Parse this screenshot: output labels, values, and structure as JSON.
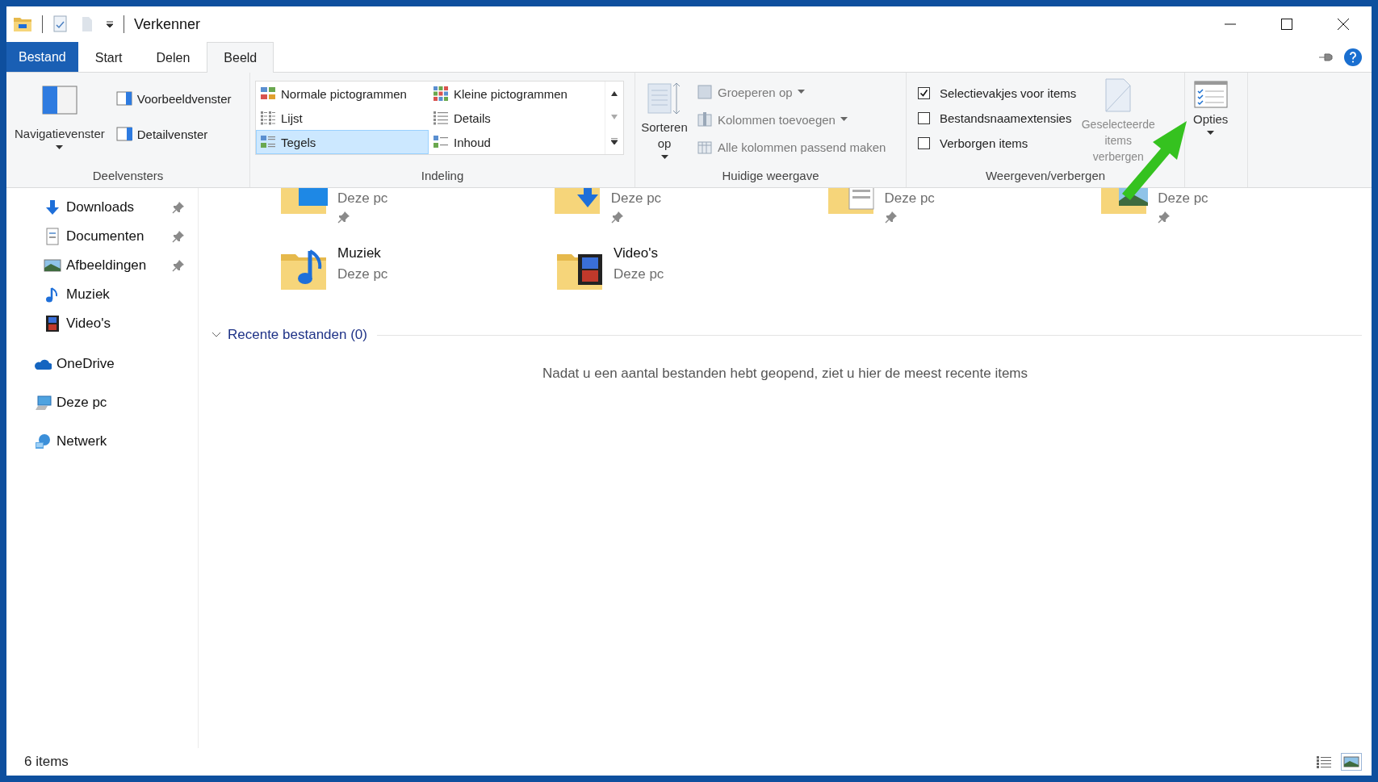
{
  "window": {
    "title": "Verkenner"
  },
  "ribbon_tabs": [
    {
      "label": "Bestand",
      "kind": "file",
      "selected": false
    },
    {
      "label": "Start",
      "kind": "tab",
      "selected": false
    },
    {
      "label": "Delen",
      "kind": "tab",
      "selected": false
    },
    {
      "label": "Beeld",
      "kind": "tab",
      "selected": true
    }
  ],
  "panes_group": {
    "label": "Deelvensters",
    "navigation_pane": "Navigatievenster",
    "items": [
      "Voorbeeldvenster",
      "Detailvenster"
    ]
  },
  "layout_group": {
    "label": "Indeling",
    "options": [
      {
        "label": "Normale pictogrammen",
        "kind": "medium",
        "selected": false
      },
      {
        "label": "Kleine pictogrammen",
        "kind": "small",
        "selected": false
      },
      {
        "label": "Lijst",
        "kind": "list",
        "selected": false
      },
      {
        "label": "Details",
        "kind": "details",
        "selected": false
      },
      {
        "label": "Tegels",
        "kind": "tiles",
        "selected": true
      },
      {
        "label": "Inhoud",
        "kind": "content",
        "selected": false
      }
    ]
  },
  "current_view_group": {
    "label": "Huidige weergave",
    "sort": {
      "label": "Sorteren op",
      "disabled": false
    },
    "items": [
      {
        "label": "Groeperen op",
        "kind": "group",
        "dropdown": true,
        "disabled": true
      },
      {
        "label": "Kolommen toevoegen",
        "kind": "columns",
        "dropdown": true,
        "disabled": true
      },
      {
        "label": "Alle kolommen passend maken",
        "kind": "fit",
        "dropdown": false,
        "disabled": true
      }
    ]
  },
  "show_hide_group": {
    "label": "Weergeven/verbergen",
    "checkboxes": [
      {
        "label": "Selectievakjes voor items",
        "checked": true
      },
      {
        "label": "Bestandsnaamextensies",
        "checked": false
      },
      {
        "label": "Verborgen items",
        "checked": false
      }
    ],
    "hide_selected": {
      "label": "Geselecteerde items verbergen",
      "disabled": true
    }
  },
  "options_button": {
    "label": "Opties"
  },
  "sidebar": {
    "quick_access_items": [
      {
        "label": "Downloads",
        "kind": "downloads",
        "pinned": true
      },
      {
        "label": "Documenten",
        "kind": "documents",
        "pinned": true
      },
      {
        "label": "Afbeeldingen",
        "kind": "pictures",
        "pinned": true
      },
      {
        "label": "Muziek",
        "kind": "music",
        "pinned": false
      },
      {
        "label": "Video's",
        "kind": "videos",
        "pinned": false
      }
    ],
    "locations": [
      {
        "label": "OneDrive",
        "kind": "cloud"
      },
      {
        "label": "Deze pc",
        "kind": "pc"
      },
      {
        "label": "Netwerk",
        "kind": "network"
      }
    ]
  },
  "folder_rows": [
    [
      {
        "kind": "desktop",
        "location": "Deze pc",
        "pinned": true
      },
      {
        "kind": "downloads",
        "location": "Deze pc",
        "pinned": true
      },
      {
        "kind": "documents",
        "location": "Deze pc",
        "pinned": true
      },
      {
        "kind": "pictures",
        "location": "Deze pc",
        "pinned": true
      }
    ],
    [
      {
        "kind": "music",
        "name": "Muziek",
        "location": "Deze pc",
        "pinned": false
      },
      {
        "kind": "videos",
        "name": "Video's",
        "location": "Deze pc",
        "pinned": false
      }
    ]
  ],
  "recent": {
    "title": "Recente bestanden (0)",
    "expanded": true,
    "empty_message": "Nadat u een aantal bestanden hebt geopend, ziet u hier de meest recente items"
  },
  "status_bar": {
    "count": "6 items",
    "view_buttons": [
      {
        "kind": "details",
        "selected": false
      },
      {
        "kind": "tiles",
        "selected": true
      }
    ]
  }
}
